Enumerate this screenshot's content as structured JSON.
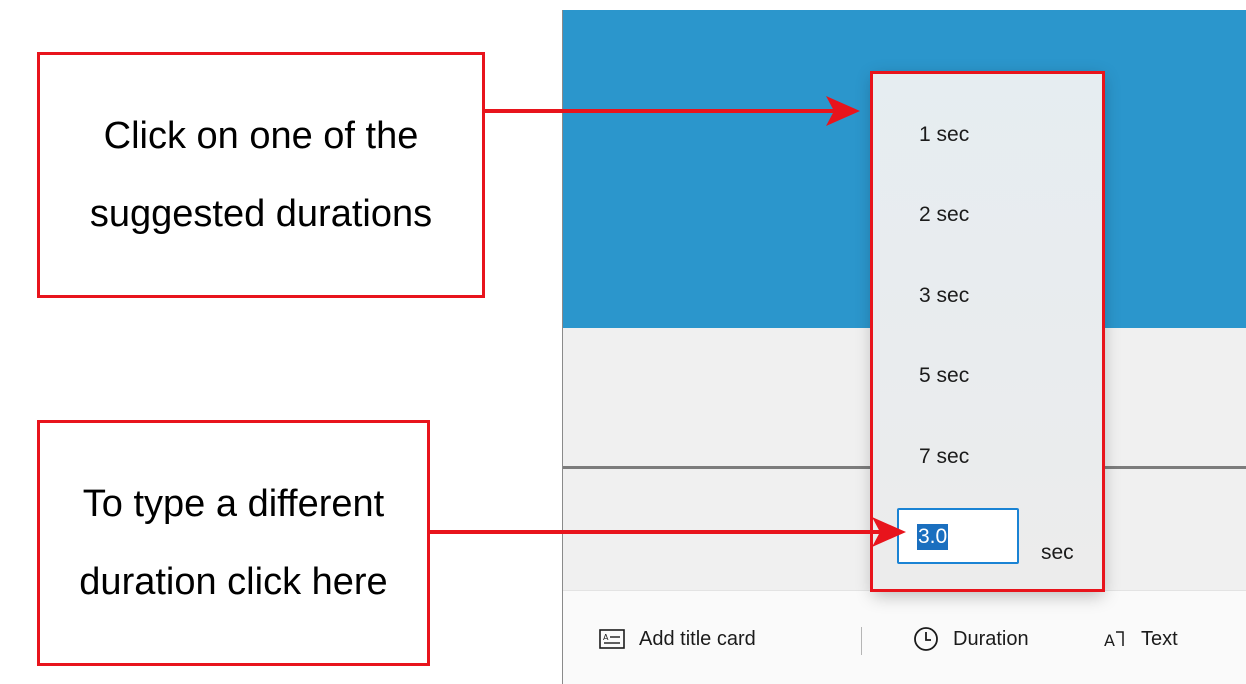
{
  "callouts": {
    "top": {
      "line1": "Click on one of the",
      "line2": "suggested durations"
    },
    "bottom": {
      "line1": "To type a different",
      "line2": "duration click here"
    }
  },
  "flyout": {
    "options": [
      "1 sec",
      "2 sec",
      "3 sec",
      "5 sec",
      "7 sec"
    ],
    "custom_value": "3.0",
    "unit": "sec"
  },
  "toolbar": {
    "title_card_label": "Add title card",
    "duration_label": "Duration",
    "text_label": "Text"
  },
  "colors": {
    "annotation_red": "#e8141c",
    "preview_blue": "#2b96cc",
    "selection_blue": "#1a6fbf"
  }
}
